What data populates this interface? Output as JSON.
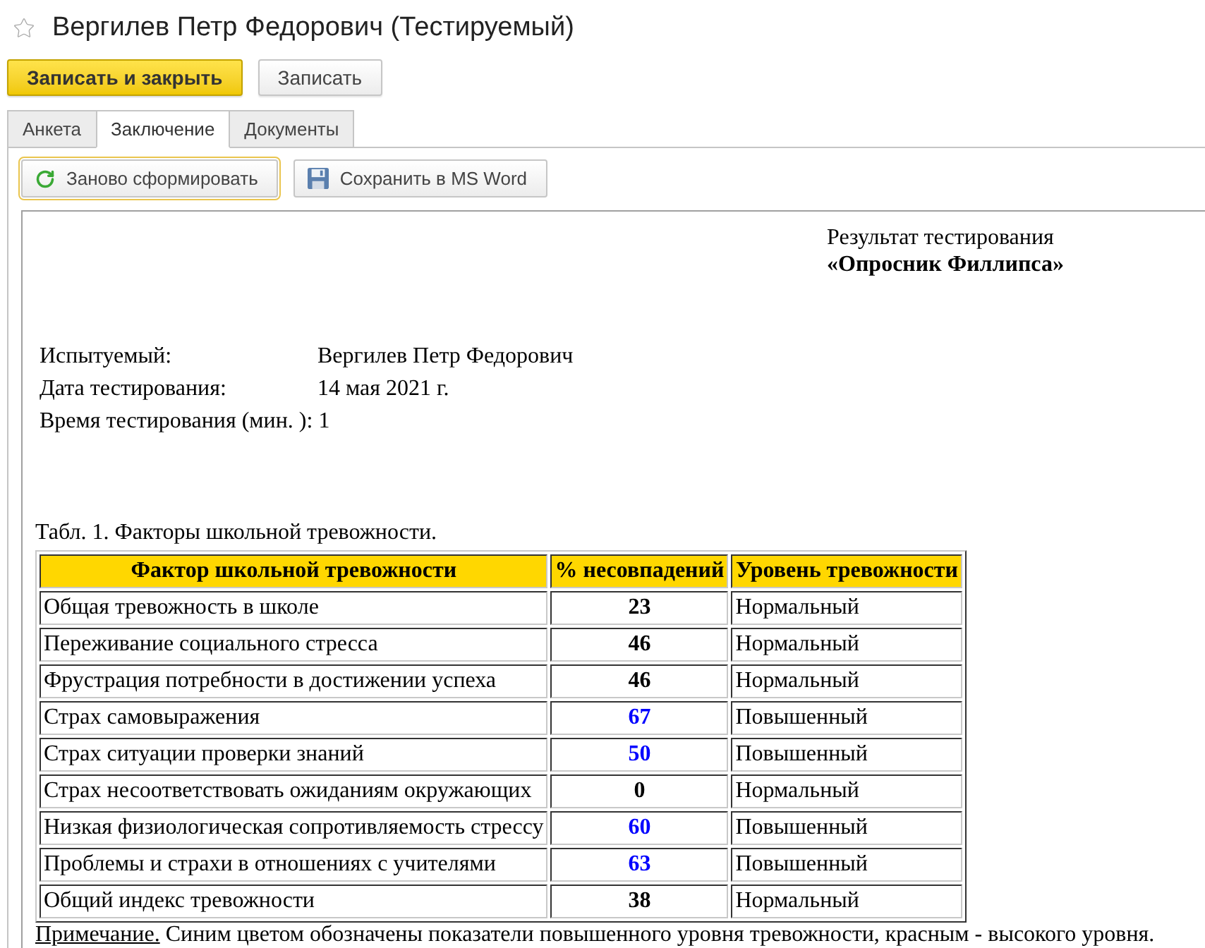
{
  "window": {
    "title": "Вергилев Петр Федорович (Тестируемый)",
    "favorite": false
  },
  "commands": [
    {
      "label": "Записать и закрыть",
      "kind": "primary"
    },
    {
      "label": "Записать",
      "kind": "default"
    }
  ],
  "tabs": [
    {
      "label": "Анкета",
      "selected": false
    },
    {
      "label": "Заключение",
      "selected": true
    },
    {
      "label": "Документы",
      "selected": false
    }
  ],
  "toolbar": [
    {
      "label": "Заново сформировать",
      "kind": "refresh",
      "focused": true
    },
    {
      "label": "Сохранить в MS Word",
      "kind": "save",
      "focused": false
    }
  ],
  "report": {
    "heading": "Результат тестирования",
    "title": "«Опросник Филлипса»",
    "fields": [
      {
        "label": "Испытуемый:",
        "value": "Вергилев Петр Федорович"
      },
      {
        "label": "Дата тестирования:",
        "value": "14 мая 2021 г."
      },
      {
        "label": "Время тестирования (мин. ):",
        "value": "1"
      }
    ],
    "table_caption": "Табл. 1. Факторы школьной тревожности.",
    "table": {
      "columns": [
        "Фактор школьной тревожности",
        "% несовпадений",
        "Уровень тревожности"
      ],
      "rows": [
        {
          "factor": "Общая тревожность в школе",
          "percent": "23",
          "anxiety": "Нормальный",
          "color": "#000000"
        },
        {
          "factor": "Переживание социального стресса",
          "percent": "46",
          "anxiety": "Нормальный",
          "color": "#000000"
        },
        {
          "factor": "Фрустрация потребности в достижении успеха",
          "percent": "46",
          "anxiety": "Нормальный",
          "color": "#000000"
        },
        {
          "factor": "Страх самовыражения",
          "percent": "67",
          "anxiety": "Повышенный",
          "color": "#0000ff"
        },
        {
          "factor": "Страх ситуации проверки знаний",
          "percent": "50",
          "anxiety": "Повышенный",
          "color": "#0000ff"
        },
        {
          "factor": "Страх несоответствовать ожиданиям окружающих",
          "percent": "0",
          "anxiety": "Нормальный",
          "color": "#000000"
        },
        {
          "factor": "Низкая физиологическая сопротивляемость стрессу",
          "percent": "60",
          "anxiety": "Повышенный",
          "color": "#0000ff"
        },
        {
          "factor": "Проблемы и страхи в отношениях с учителями",
          "percent": "63",
          "anxiety": "Повышенный",
          "color": "#0000ff"
        },
        {
          "factor": "Общий индекс тревожности",
          "percent": "38",
          "anxiety": "Нормальный",
          "color": "#000000"
        }
      ]
    },
    "note": {
      "label": "Примечание.",
      "text": "Синим цветом обозначены показатели повышенного уровня тревожности, красным - высокого уровня."
    }
  }
}
